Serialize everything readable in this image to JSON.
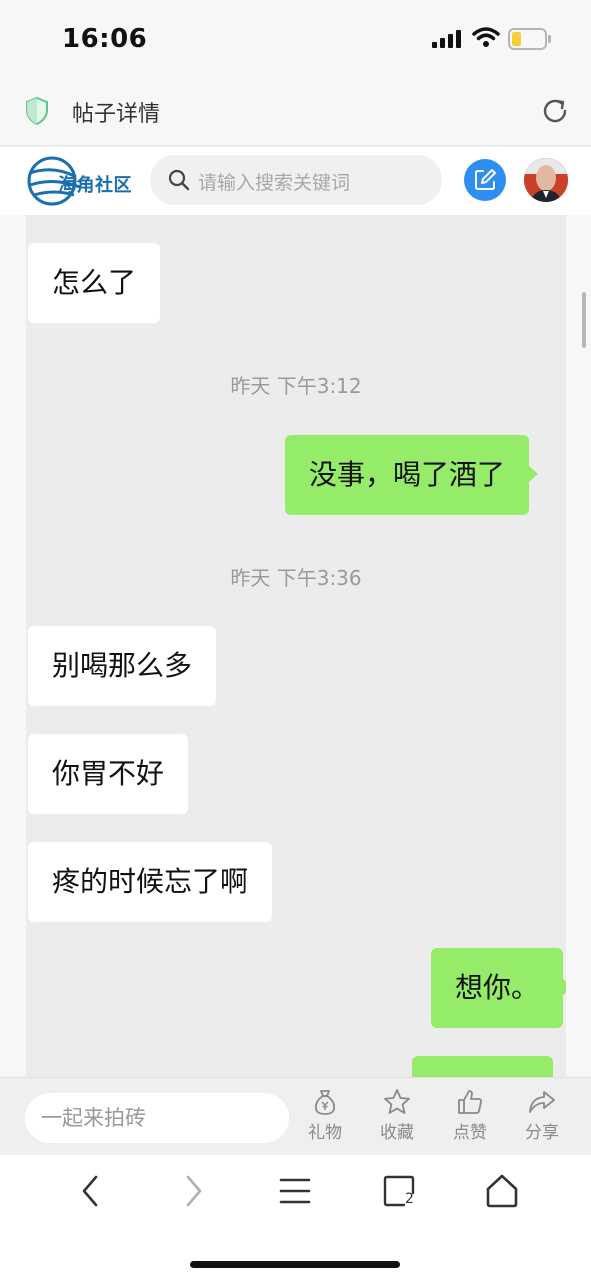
{
  "status_bar": {
    "time": "16:06"
  },
  "browser": {
    "page_title": "帖子详情"
  },
  "site": {
    "logo_text": "海角社区",
    "search_placeholder": "请输入搜索关键词"
  },
  "chat": {
    "messages": [
      {
        "side": "left",
        "text": "怎么了"
      },
      {
        "type": "timestamp",
        "text": "昨天 下午3:12"
      },
      {
        "side": "right",
        "text": "没事，喝了酒了"
      },
      {
        "type": "timestamp",
        "text": "昨天 下午3:36"
      },
      {
        "side": "left",
        "text": "别喝那么多"
      },
      {
        "side": "left",
        "text": "你胃不好"
      },
      {
        "side": "left",
        "text": "疼的时候忘了啊"
      },
      {
        "side": "right",
        "text": "想你。"
      },
      {
        "side": "right",
        "text": ""
      }
    ]
  },
  "action_bar": {
    "input_placeholder": "一起来拍砖",
    "actions": [
      {
        "icon": "money-bag-icon",
        "label": "礼物"
      },
      {
        "icon": "star-icon",
        "label": "收藏"
      },
      {
        "icon": "thumbs-up-icon",
        "label": "点赞"
      },
      {
        "icon": "share-icon",
        "label": "分享"
      }
    ]
  },
  "nav_bar": {
    "tab_count": "2"
  },
  "colors": {
    "sent_bubble": "#95ec69",
    "received_bubble": "#ffffff",
    "chat_background": "#ececec",
    "accent_blue": "#2f8ff0"
  }
}
